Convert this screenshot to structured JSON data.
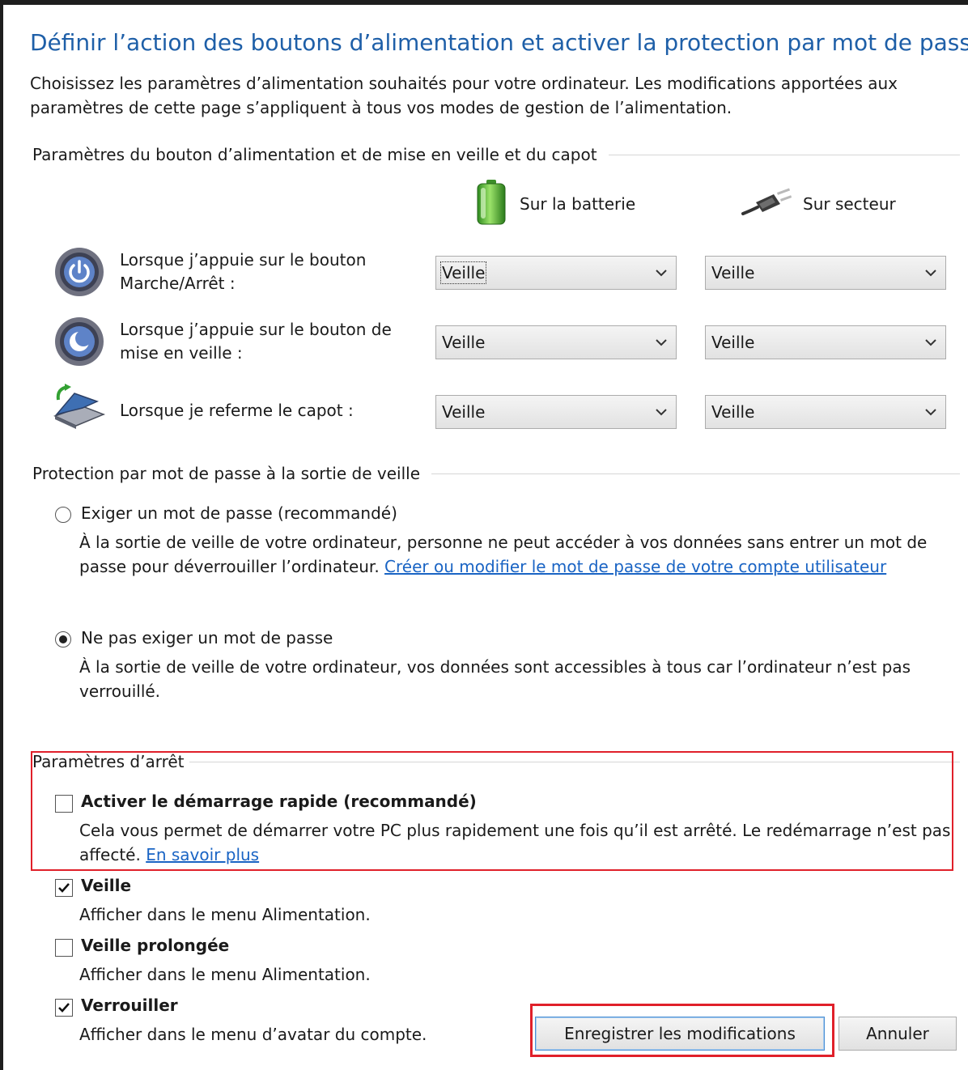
{
  "title": "Définir l’action des boutons d’alimentation et activer la protection par mot de passe",
  "intro": "Choisissez les paramètres d’alimentation souhaités pour votre ordinateur. Les modifications apportées aux paramètres de cette page s’appliquent à tous vos modes de gestion de l’alimentation.",
  "power_settings": {
    "heading": "Paramètres du bouton d’alimentation et de mise en veille et du capot",
    "col_battery": "Sur la batterie",
    "col_ac": "Sur secteur",
    "rows": [
      {
        "label": "Lorsque j’appuie sur le bouton Marche/Arrêt :",
        "battery": "Veille",
        "ac": "Veille"
      },
      {
        "label": "Lorsque j’appuie sur le bouton de mise en veille :",
        "battery": "Veille",
        "ac": "Veille"
      },
      {
        "label": "Lorsque je referme le capot :",
        "battery": "Veille",
        "ac": "Veille"
      }
    ]
  },
  "password": {
    "heading": "Protection par mot de passe à la sortie de veille",
    "require": {
      "title": "Exiger un mot de passe (recommandé)",
      "desc": "À la sortie de veille de votre ordinateur, personne ne peut accéder à vos données sans entrer un mot de passe pour déverrouiller l’ordinateur.",
      "link": "Créer ou modifier le mot de passe de votre compte utilisateur",
      "checked": false
    },
    "no_require": {
      "title": "Ne pas exiger un mot de passe",
      "desc": "À la sortie de veille de votre ordinateur, vos données sont accessibles à tous car l’ordinateur n’est pas verrouillé.",
      "checked": true
    }
  },
  "shutdown": {
    "heading": "Paramètres d’arrêt",
    "fast_startup": {
      "title": "Activer le démarrage rapide (recommandé)",
      "desc": "Cela vous permet de démarrer votre PC plus rapidement une fois qu’il est arrêté. Le redémarrage n’est pas affecté.",
      "link": "En savoir plus",
      "checked": false
    },
    "sleep": {
      "title": "Veille",
      "desc": "Afficher dans le menu Alimentation.",
      "checked": true
    },
    "hibernate": {
      "title": "Veille prolongée",
      "desc": "Afficher dans le menu Alimentation.",
      "checked": false
    },
    "lock": {
      "title": "Verrouiller",
      "desc": "Afficher dans le menu d’avatar du compte.",
      "checked": true
    }
  },
  "buttons": {
    "save": "Enregistrer les modifications",
    "cancel": "Annuler"
  },
  "colors": {
    "title": "#1e5fa8",
    "link": "#1a64c4",
    "highlight": "#e0202a"
  }
}
